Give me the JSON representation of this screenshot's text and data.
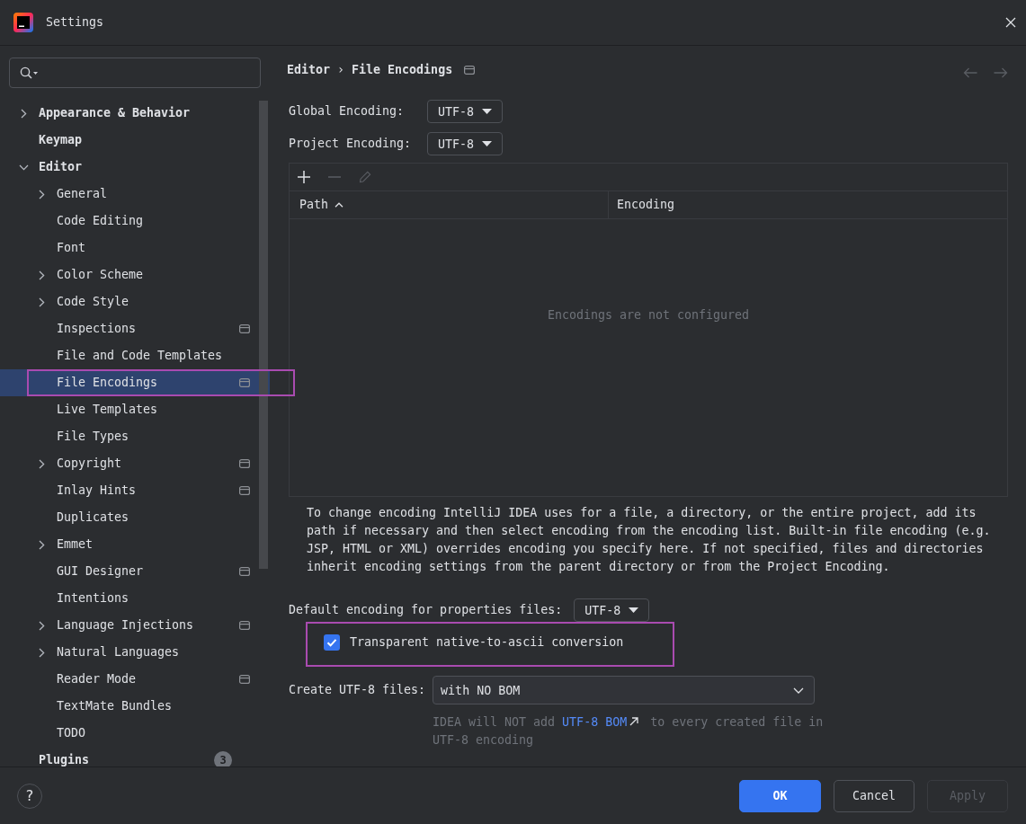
{
  "window": {
    "title": "Settings"
  },
  "sidebar": {
    "tree": [
      {
        "label": "Appearance & Behavior",
        "expanded": false,
        "selected": false
      },
      {
        "label": "Keymap",
        "selected": false
      },
      {
        "label": "Editor",
        "expanded": true,
        "selected": false,
        "children": [
          {
            "label": "General",
            "expanded": false,
            "selected": false
          },
          {
            "label": "Code Editing",
            "selected": false
          },
          {
            "label": "Font",
            "selected": false
          },
          {
            "label": "Color Scheme",
            "expanded": false,
            "selected": false
          },
          {
            "label": "Code Style",
            "expanded": false,
            "selected": false
          },
          {
            "label": "Inspections",
            "selected": false,
            "project_level": true
          },
          {
            "label": "File and Code Templates",
            "selected": false
          },
          {
            "label": "File Encodings",
            "selected": true,
            "project_level": true,
            "annotation_frame": true
          },
          {
            "label": "Live Templates",
            "selected": false
          },
          {
            "label": "File Types",
            "selected": false
          },
          {
            "label": "Copyright",
            "expanded": false,
            "selected": false,
            "project_level": true
          },
          {
            "label": "Inlay Hints",
            "selected": false,
            "project_level": true
          },
          {
            "label": "Duplicates",
            "selected": false
          },
          {
            "label": "Emmet",
            "expanded": false,
            "selected": false
          },
          {
            "label": "GUI Designer",
            "selected": false,
            "project_level": true
          },
          {
            "label": "Intentions",
            "selected": false
          },
          {
            "label": "Language Injections",
            "expanded": false,
            "selected": false,
            "project_level": true
          },
          {
            "label": "Natural Languages",
            "expanded": false,
            "selected": false
          },
          {
            "label": "Reader Mode",
            "selected": false,
            "project_level": true
          },
          {
            "label": "TextMate Bundles",
            "selected": false
          },
          {
            "label": "TODO",
            "selected": false
          }
        ]
      },
      {
        "label": "Plugins",
        "selected": false,
        "badge": "3"
      }
    ]
  },
  "page": {
    "breadcrumb": [
      "Editor",
      "File Encodings"
    ],
    "breadcrumb_separator": "›",
    "project_level": true,
    "navigation": [
      {
        "kind": "back",
        "disabled": true
      },
      {
        "kind": "forward",
        "disabled": true
      }
    ],
    "encodings": [
      {
        "label": "Global Encoding:",
        "value": "UTF-8"
      },
      {
        "label": "Project Encoding:",
        "value": "UTF-8"
      }
    ],
    "table": {
      "toolbar": [
        {
          "kind": "add",
          "disabled": false
        },
        {
          "kind": "remove",
          "disabled": true
        },
        {
          "kind": "edit",
          "disabled": true
        }
      ],
      "columns": [
        {
          "label": "Path",
          "sort_ascending": true
        },
        {
          "label": "Encoding",
          "sort_ascending": false
        }
      ],
      "empty_text": "Encodings are not configured"
    },
    "description": "To change encoding IntelliJ IDEA uses for a file, a directory, or the entire project, add its path if necessary and then select encoding from the encoding list. Built-in file encoding (e.g. JSP, HTML or XML) overrides encoding you specify here. If not specified, files and directories inherit encoding settings from the parent directory or from the Project Encoding.",
    "properties_encoding": {
      "label": "Default encoding for properties files:",
      "value": "UTF-8"
    },
    "native_to_ascii": {
      "label": "Transparent native-to-ascii conversion",
      "checked": true,
      "annotation_frame": true
    },
    "bom": {
      "label": "Create UTF-8 files:",
      "value": "with NO BOM",
      "hint": {
        "before": "IDEA will NOT add ",
        "link": "UTF-8 BOM",
        "after": " to every created file in UTF-8 encoding"
      }
    }
  },
  "footer": {
    "help": "?",
    "buttons": [
      {
        "label": "OK",
        "kind": "ok",
        "disabled": false
      },
      {
        "label": "Cancel",
        "kind": "cancel",
        "disabled": false
      },
      {
        "label": "Apply",
        "kind": "apply",
        "disabled": true
      }
    ]
  }
}
